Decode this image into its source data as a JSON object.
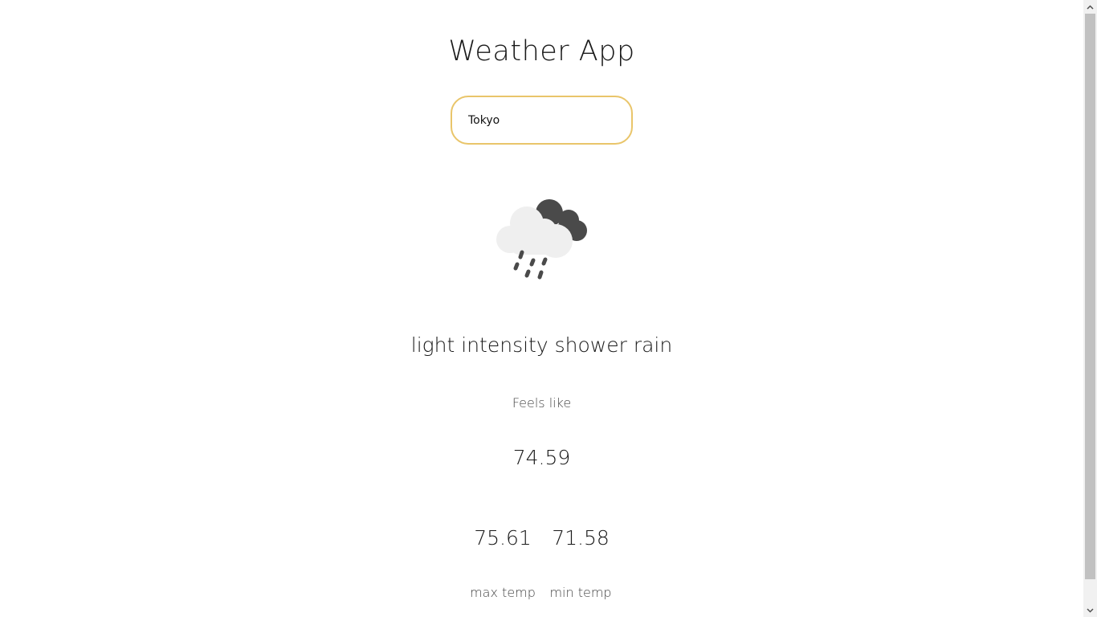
{
  "header": {
    "title": "Weather App"
  },
  "search": {
    "value": "Tokyo"
  },
  "weather": {
    "icon": "rain-cloud-icon",
    "description": "light intensity shower rain"
  },
  "feels_like": {
    "label": "Feels like",
    "value": "74.59"
  },
  "temps": {
    "max": {
      "value": "75.61",
      "label": "max temp"
    },
    "min": {
      "value": "71.58",
      "label": "min temp"
    }
  },
  "colors": {
    "input_border": "#e9c56a",
    "cloud_dark": "#4a4a4a",
    "cloud_light": "#efefef"
  },
  "scrollbar": {
    "position": 0.0
  }
}
